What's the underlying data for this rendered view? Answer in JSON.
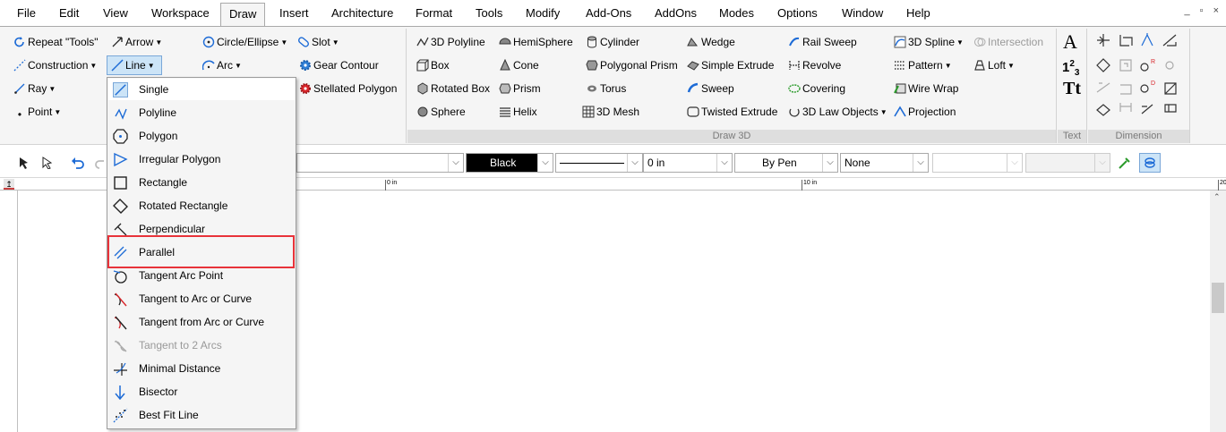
{
  "menubar": {
    "items": [
      "File",
      "Edit",
      "View",
      "Workspace",
      "Draw",
      "Insert",
      "Architecture",
      "Format",
      "Tools",
      "Modify",
      "Add-Ons",
      "AddOns",
      "Modes",
      "Options",
      "Window",
      "Help"
    ],
    "active": "Draw",
    "window_controls": "_ ▫ ×"
  },
  "ribbon": {
    "tools": {
      "repeat": "Repeat \"Tools\"",
      "arrow": "Arrow",
      "circle": "Circle/Ellipse",
      "slot": "Slot",
      "construction": "Construction",
      "line": "Line",
      "arc": "Arc",
      "gear": "Gear Contour",
      "ray": "Ray",
      "stellated": "Stellated Polygon",
      "point": "Point"
    },
    "draw3d": {
      "label": "Draw 3D",
      "polyline3d": "3D Polyline",
      "hemisphere": "HemiSphere",
      "cylinder": "Cylinder",
      "wedge": "Wedge",
      "railsweep": "Rail Sweep",
      "spline3d": "3D Spline",
      "intersection": "Intersection",
      "box": "Box",
      "cone": "Cone",
      "polyprism": "Polygonal Prism",
      "simpleextrude": "Simple Extrude",
      "revolve": "Revolve",
      "pattern": "Pattern",
      "loft": "Loft",
      "rotatedbox": "Rotated Box",
      "prism": "Prism",
      "torus": "Torus",
      "sweep": "Sweep",
      "covering": "Covering",
      "wirewrap": "Wire Wrap",
      "sphere": "Sphere",
      "helix": "Helix",
      "mesh3d": "3D Mesh",
      "twistedextrude": "Twisted Extrude",
      "lawobjects": "3D Law Objects",
      "projection": "Projection"
    },
    "text": {
      "label": "Text",
      "big_a": "A",
      "num": "1",
      "num_sub": "2",
      "num_sub2": "3",
      "tt": "Tt"
    },
    "dimension": {
      "label": "Dimension"
    }
  },
  "toolbar": {
    "color": "Black",
    "thickness": "0 in",
    "pen": "By Pen",
    "none": "None"
  },
  "ruler": {
    "label0": "0 in",
    "label10": "10 in",
    "label20": "20"
  },
  "dropdown": {
    "items": [
      {
        "label": "Single",
        "icon": "line-single-icon",
        "state": "selected"
      },
      {
        "label": "Polyline",
        "icon": "polyline-icon",
        "state": "normal"
      },
      {
        "label": "Polygon",
        "icon": "polygon-icon",
        "state": "normal"
      },
      {
        "label": "Irregular Polygon",
        "icon": "irregular-polygon-icon",
        "state": "normal"
      },
      {
        "label": "Rectangle",
        "icon": "rectangle-icon",
        "state": "normal"
      },
      {
        "label": "Rotated Rectangle",
        "icon": "rotated-rectangle-icon",
        "state": "normal"
      },
      {
        "label": "Perpendicular",
        "icon": "perpendicular-icon",
        "state": "normal"
      },
      {
        "label": "Parallel",
        "icon": "parallel-icon",
        "state": "highlighted"
      },
      {
        "label": "Tangent Arc Point",
        "icon": "tangent-arc-point-icon",
        "state": "normal"
      },
      {
        "label": "Tangent to Arc or Curve",
        "icon": "tangent-to-arc-icon",
        "state": "normal"
      },
      {
        "label": "Tangent from Arc or Curve",
        "icon": "tangent-from-arc-icon",
        "state": "normal"
      },
      {
        "label": "Tangent to 2 Arcs",
        "icon": "tangent-2-arcs-icon",
        "state": "disabled"
      },
      {
        "label": "Minimal Distance",
        "icon": "minimal-distance-icon",
        "state": "normal"
      },
      {
        "label": "Bisector",
        "icon": "bisector-icon",
        "state": "normal"
      },
      {
        "label": "Best Fit Line",
        "icon": "best-fit-line-icon",
        "state": "normal"
      }
    ]
  },
  "colors": {
    "accent": "#1d6bd6",
    "highlight": "#e8333a",
    "ribbon_bg": "#f5f5f5"
  }
}
